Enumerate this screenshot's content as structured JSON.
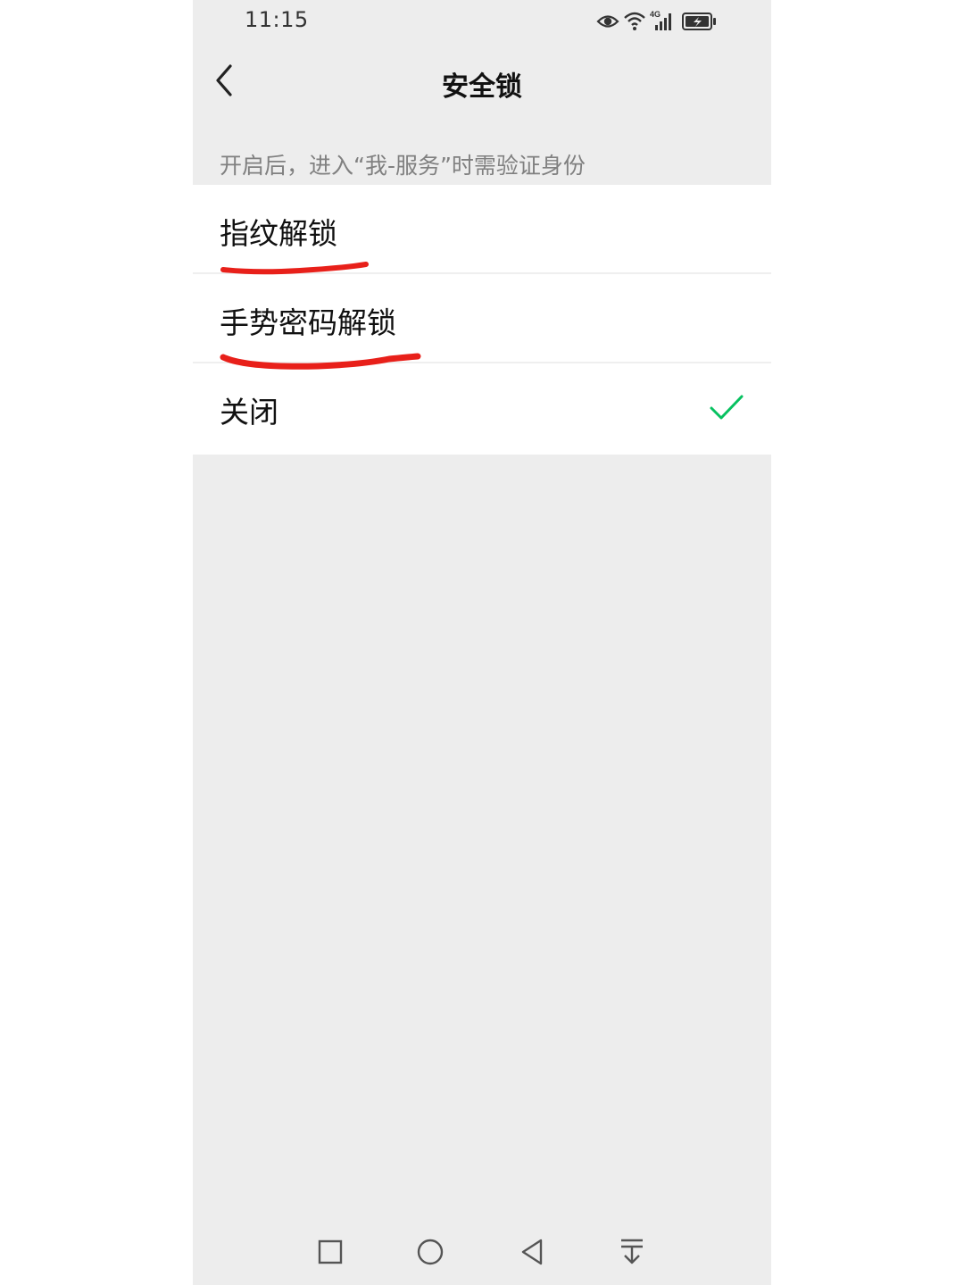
{
  "status_bar": {
    "time": "11:15",
    "network_label": "4G",
    "icons": [
      "eye-icon",
      "wifi-icon",
      "signal-icon",
      "battery-charging-icon"
    ]
  },
  "nav": {
    "title": "安全锁",
    "back_icon": "chevron-left-icon"
  },
  "hint": "开启后，进入“我-服务”时需验证身份",
  "options": [
    {
      "label": "指纹解锁",
      "selected": false
    },
    {
      "label": "手势密码解锁",
      "selected": false
    },
    {
      "label": "关闭",
      "selected": true
    }
  ],
  "system_nav": {
    "icons": [
      "recents-square-icon",
      "home-circle-icon",
      "back-triangle-icon",
      "notification-pulldown-icon"
    ]
  },
  "colors": {
    "background": "#ededed",
    "card": "#ffffff",
    "check": "#07c160",
    "annotation": "#e8201a"
  }
}
